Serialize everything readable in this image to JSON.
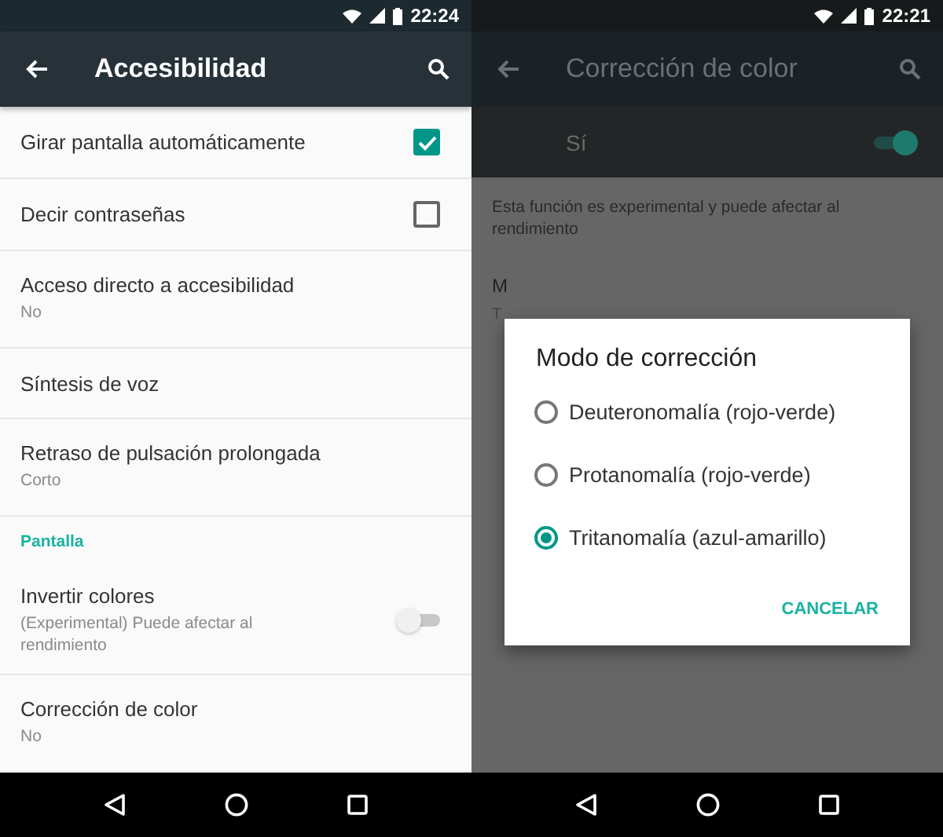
{
  "left_screen": {
    "status_bar": {
      "time": "22:24"
    },
    "app_bar": {
      "title": "Accesibilidad"
    },
    "items": [
      {
        "kind": "checkbox",
        "title": "Girar pantalla automáticamente",
        "checked": true
      },
      {
        "kind": "checkbox",
        "title": "Decir contraseñas",
        "checked": false
      },
      {
        "kind": "text",
        "title": "Acceso directo a accesibilidad",
        "summary": "No"
      },
      {
        "kind": "text",
        "title": "Síntesis de voz"
      },
      {
        "kind": "text",
        "title": "Retraso de pulsación prolongada",
        "summary": "Corto"
      },
      {
        "kind": "header",
        "title": "Pantalla"
      },
      {
        "kind": "switch",
        "title": "Invertir colores",
        "summary": "(Experimental) Puede afectar al rendimiento",
        "on": false
      },
      {
        "kind": "text",
        "title": "Corrección de color",
        "summary": "No"
      }
    ]
  },
  "right_screen": {
    "status_bar": {
      "time": "22:21"
    },
    "app_bar": {
      "title": "Corrección de color"
    },
    "master_switch": {
      "label": "Sí",
      "on": true
    },
    "description": "Esta función es experimental y puede afectar al rendimiento",
    "covered_item": {
      "title": "M",
      "summary": "T"
    },
    "dialog": {
      "title": "Modo de corrección",
      "options": [
        {
          "label": "Deuteronomalía (rojo-verde)",
          "selected": false
        },
        {
          "label": "Protanomalía (rojo-verde)",
          "selected": false
        },
        {
          "label": "Tritanomalía (azul-amarillo)",
          "selected": true
        }
      ],
      "button": "CANCELAR"
    }
  }
}
